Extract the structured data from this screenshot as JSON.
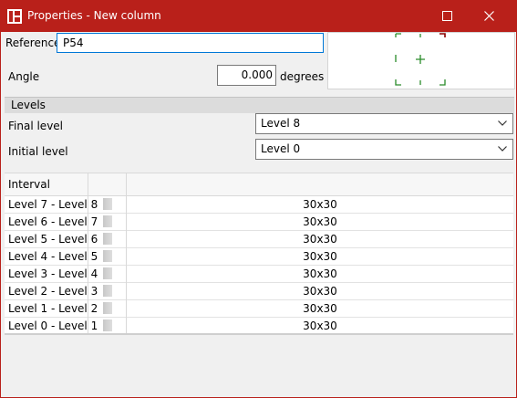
{
  "window": {
    "title": "Properties - New column",
    "title_bar_color": "#b9201a"
  },
  "form": {
    "reference_label": "Reference",
    "reference_value": "P54",
    "angle_label": "Angle",
    "angle_value": "0.000",
    "angle_unit": "degrees"
  },
  "preview": {
    "corner_marker_colors": [
      "#2a8c2a",
      "#8b0000"
    ]
  },
  "levels": {
    "section_title": "Levels",
    "final_level_label": "Final level",
    "final_level_value": "Level 8",
    "initial_level_label": "Initial level",
    "initial_level_value": "Level 0"
  },
  "table": {
    "columns": [
      "Interval",
      "",
      ""
    ],
    "rows": [
      {
        "interval": "Level 7 - Level 8",
        "section": "30x30"
      },
      {
        "interval": "Level 6 - Level 7",
        "section": "30x30"
      },
      {
        "interval": "Level 5 - Level 6",
        "section": "30x30"
      },
      {
        "interval": "Level 4 - Level 5",
        "section": "30x30"
      },
      {
        "interval": "Level 3 - Level 4",
        "section": "30x30"
      },
      {
        "interval": "Level 2 - Level 3",
        "section": "30x30"
      },
      {
        "interval": "Level 1 - Level 2",
        "section": "30x30"
      },
      {
        "interval": "Level 0 - Level 1",
        "section": "30x30"
      }
    ]
  }
}
